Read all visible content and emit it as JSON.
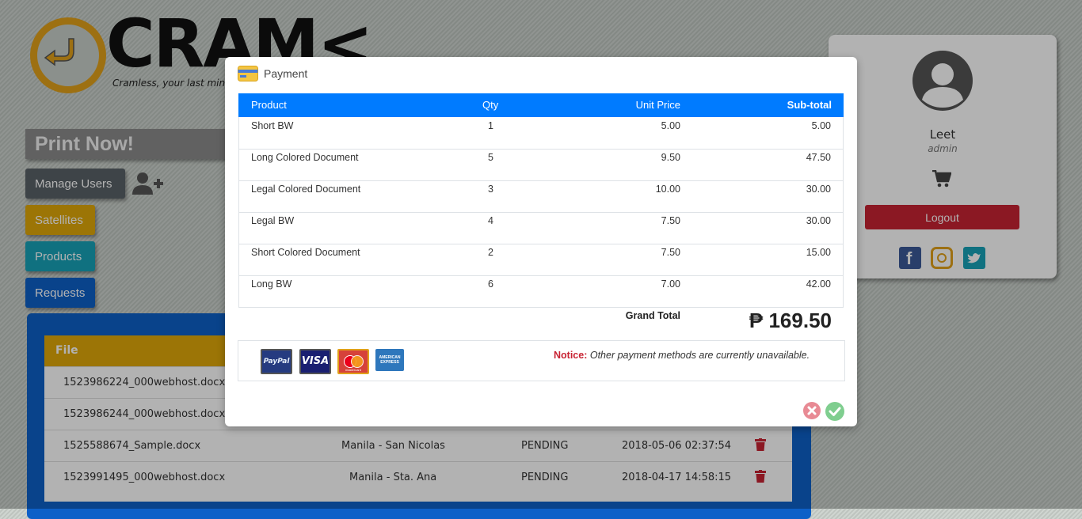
{
  "brand": {
    "name": "CRAM<",
    "tagline": "Cramless, your last minut"
  },
  "sidebar": {
    "print_now": "Print Now!",
    "manage_users": "Manage Users",
    "satellites": "Satellites",
    "products": "Products",
    "requests": "Requests"
  },
  "requests_table": {
    "header_file": "File",
    "rows": [
      {
        "file": "1523986224_000webhost.docx",
        "location": "",
        "status": "",
        "date": ""
      },
      {
        "file": "1523986244_000webhost.docx",
        "location": "",
        "status": "",
        "date": ""
      },
      {
        "file": "1525588674_Sample.docx",
        "location": "Manila - San Nicolas",
        "status": "PENDING",
        "date": "2018-05-06 02:37:54"
      },
      {
        "file": "1523991495_000webhost.docx",
        "location": "Manila - Sta. Ana",
        "status": "PENDING",
        "date": "2018-04-17 14:58:15"
      }
    ]
  },
  "profile": {
    "name": "Leet",
    "role": "admin",
    "logout": "Logout"
  },
  "modal": {
    "title": "Payment",
    "columns": {
      "product": "Product",
      "qty": "Qty",
      "unit_price": "Unit Price",
      "subtotal": "Sub-total"
    },
    "items": [
      {
        "product": "Short BW",
        "qty": "1",
        "unit_price": "5.00",
        "subtotal": "5.00"
      },
      {
        "product": "Long Colored Document",
        "qty": "5",
        "unit_price": "9.50",
        "subtotal": "47.50"
      },
      {
        "product": "Legal Colored Document",
        "qty": "3",
        "unit_price": "10.00",
        "subtotal": "30.00"
      },
      {
        "product": "Legal BW",
        "qty": "4",
        "unit_price": "7.50",
        "subtotal": "30.00"
      },
      {
        "product": "Short Colored Document",
        "qty": "2",
        "unit_price": "7.50",
        "subtotal": "15.00"
      },
      {
        "product": "Long BW",
        "qty": "6",
        "unit_price": "7.00",
        "subtotal": "42.00"
      }
    ],
    "grand_total_label": "Grand Total",
    "grand_total_value": "₱ 169.50",
    "payment_cards": [
      "PayPal",
      "VISA",
      "mastercard",
      "AMERICAN EXPRESS"
    ],
    "notice_label": "Notice:",
    "notice_text": "Other payment methods are currently unavailable."
  },
  "colors": {
    "primary": "#007bff",
    "danger": "#c82333",
    "warning": "#e0a80a",
    "teal": "#17a2b8"
  }
}
